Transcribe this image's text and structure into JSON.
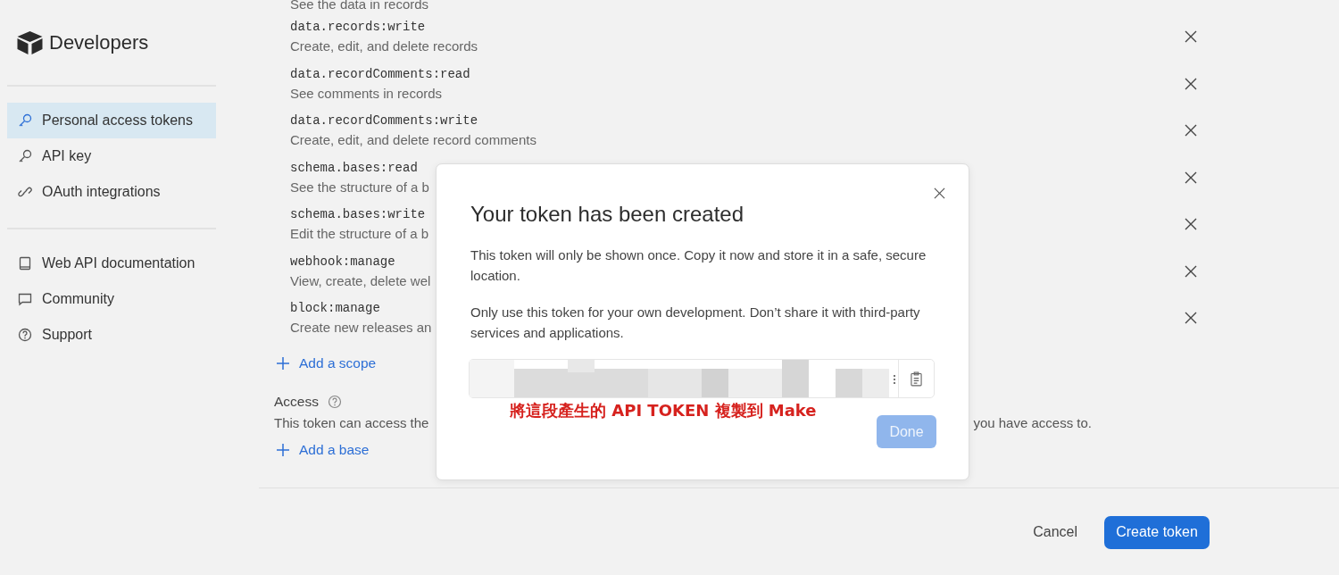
{
  "sidebar": {
    "logo": "Developers",
    "groups": [
      [
        {
          "label": "Personal access tokens",
          "kind": "key",
          "selected": true
        },
        {
          "label": "API key",
          "kind": "key",
          "selected": false
        },
        {
          "label": "OAuth integrations",
          "kind": "link",
          "selected": false
        }
      ],
      [
        {
          "label": "Web API documentation",
          "kind": "book",
          "selected": false
        },
        {
          "label": "Community",
          "kind": "chat",
          "selected": false
        },
        {
          "label": "Support",
          "kind": "help",
          "selected": false
        }
      ]
    ]
  },
  "scope_above": {
    "description": "See the data in records"
  },
  "scopes": [
    {
      "name": "data.records:write",
      "description": "Create, edit, and delete records"
    },
    {
      "name": "data.recordComments:read",
      "description": "See comments in records"
    },
    {
      "name": "data.recordComments:write",
      "description": "Create, edit, and delete record comments"
    },
    {
      "name": "schema.bases:read",
      "description": "See the structure of a b"
    },
    {
      "name": "schema.bases:write",
      "description": "Edit the structure of a b"
    },
    {
      "name": "webhook:manage",
      "description": "View, create, delete wel"
    },
    {
      "name": "block:manage",
      "description": "Create new releases an"
    }
  ],
  "add_scope": "Add a scope",
  "access": {
    "title": "Access",
    "description_start": "This token can access the",
    "description_end": "you have access to.",
    "add_base": "Add a base"
  },
  "footer": {
    "cancel": "Cancel",
    "create": "Create token"
  },
  "modal": {
    "title": "Your token has been created",
    "paragraphs": [
      "This token will only be shown once. Copy it now and store it in a safe, secure location.",
      "Only use this token for your own development. Don’t share it with third-party services and applications."
    ],
    "annotation": "將這段產生的 API TOKEN 複製到 Make",
    "done": {
      "label": "Done",
      "disabled": true
    }
  }
}
